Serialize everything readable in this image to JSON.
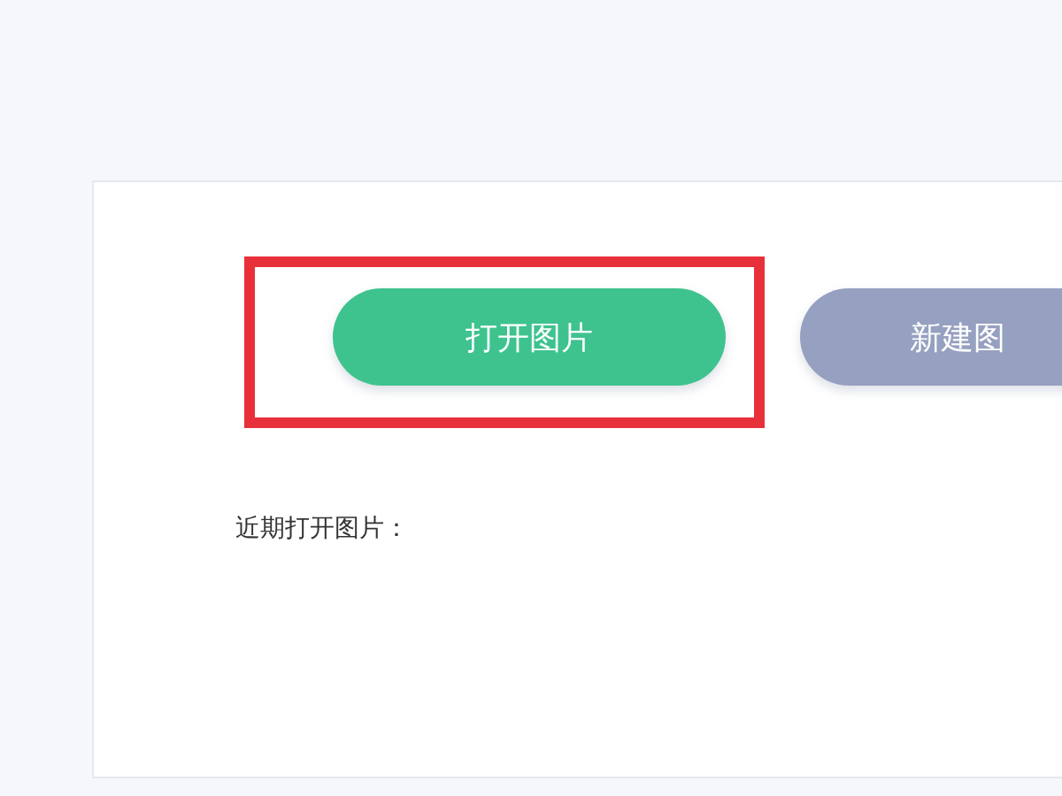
{
  "buttons": [
    {
      "label": "打开图片",
      "kind": "primary",
      "highlighted": true
    },
    {
      "label": "新建图",
      "kind": "secondary",
      "highlighted": false
    }
  ],
  "recent": {
    "label": "近期打开图片："
  }
}
